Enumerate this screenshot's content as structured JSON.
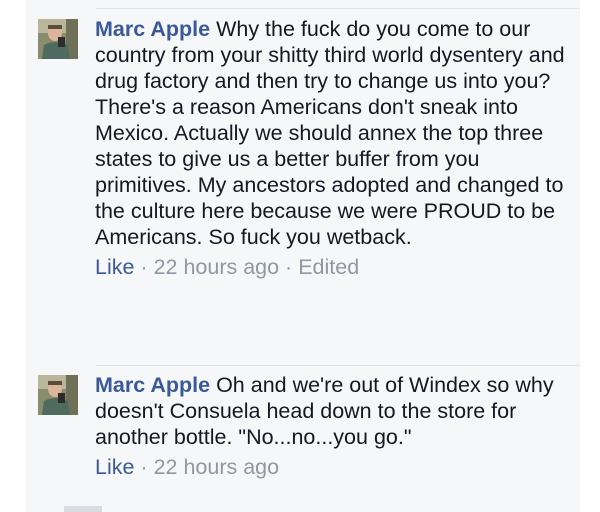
{
  "comments": [
    {
      "author": "Marc Apple",
      "text": "Why the fuck do you come to our country from your shitty third world dysentery and drug factory and then try to change us into you? There's a reason Americans don't sneak into Mexico. Actually we should annex the top three states to give us a better buffer from you primitives. My ancestors adopted and changed to the culture here because we were PROUD to be Americans. So fuck you wetback.",
      "like_label": "Like",
      "separator": " · ",
      "timestamp": "22 hours ago",
      "edited_label": "Edited"
    },
    {
      "author": "Marc Apple",
      "text": "Oh and we're out of Windex so why doesn't Consuela head down to the store for another bottle. \"No...no...you go.\"",
      "like_label": "Like",
      "separator": " · ",
      "timestamp": "22 hours ago"
    }
  ],
  "colors": {
    "link": "#3b5998",
    "meta": "#9197a3",
    "text": "#141823",
    "background": "#f6f7f9"
  },
  "icons": {
    "avatar": "profile-photo"
  }
}
